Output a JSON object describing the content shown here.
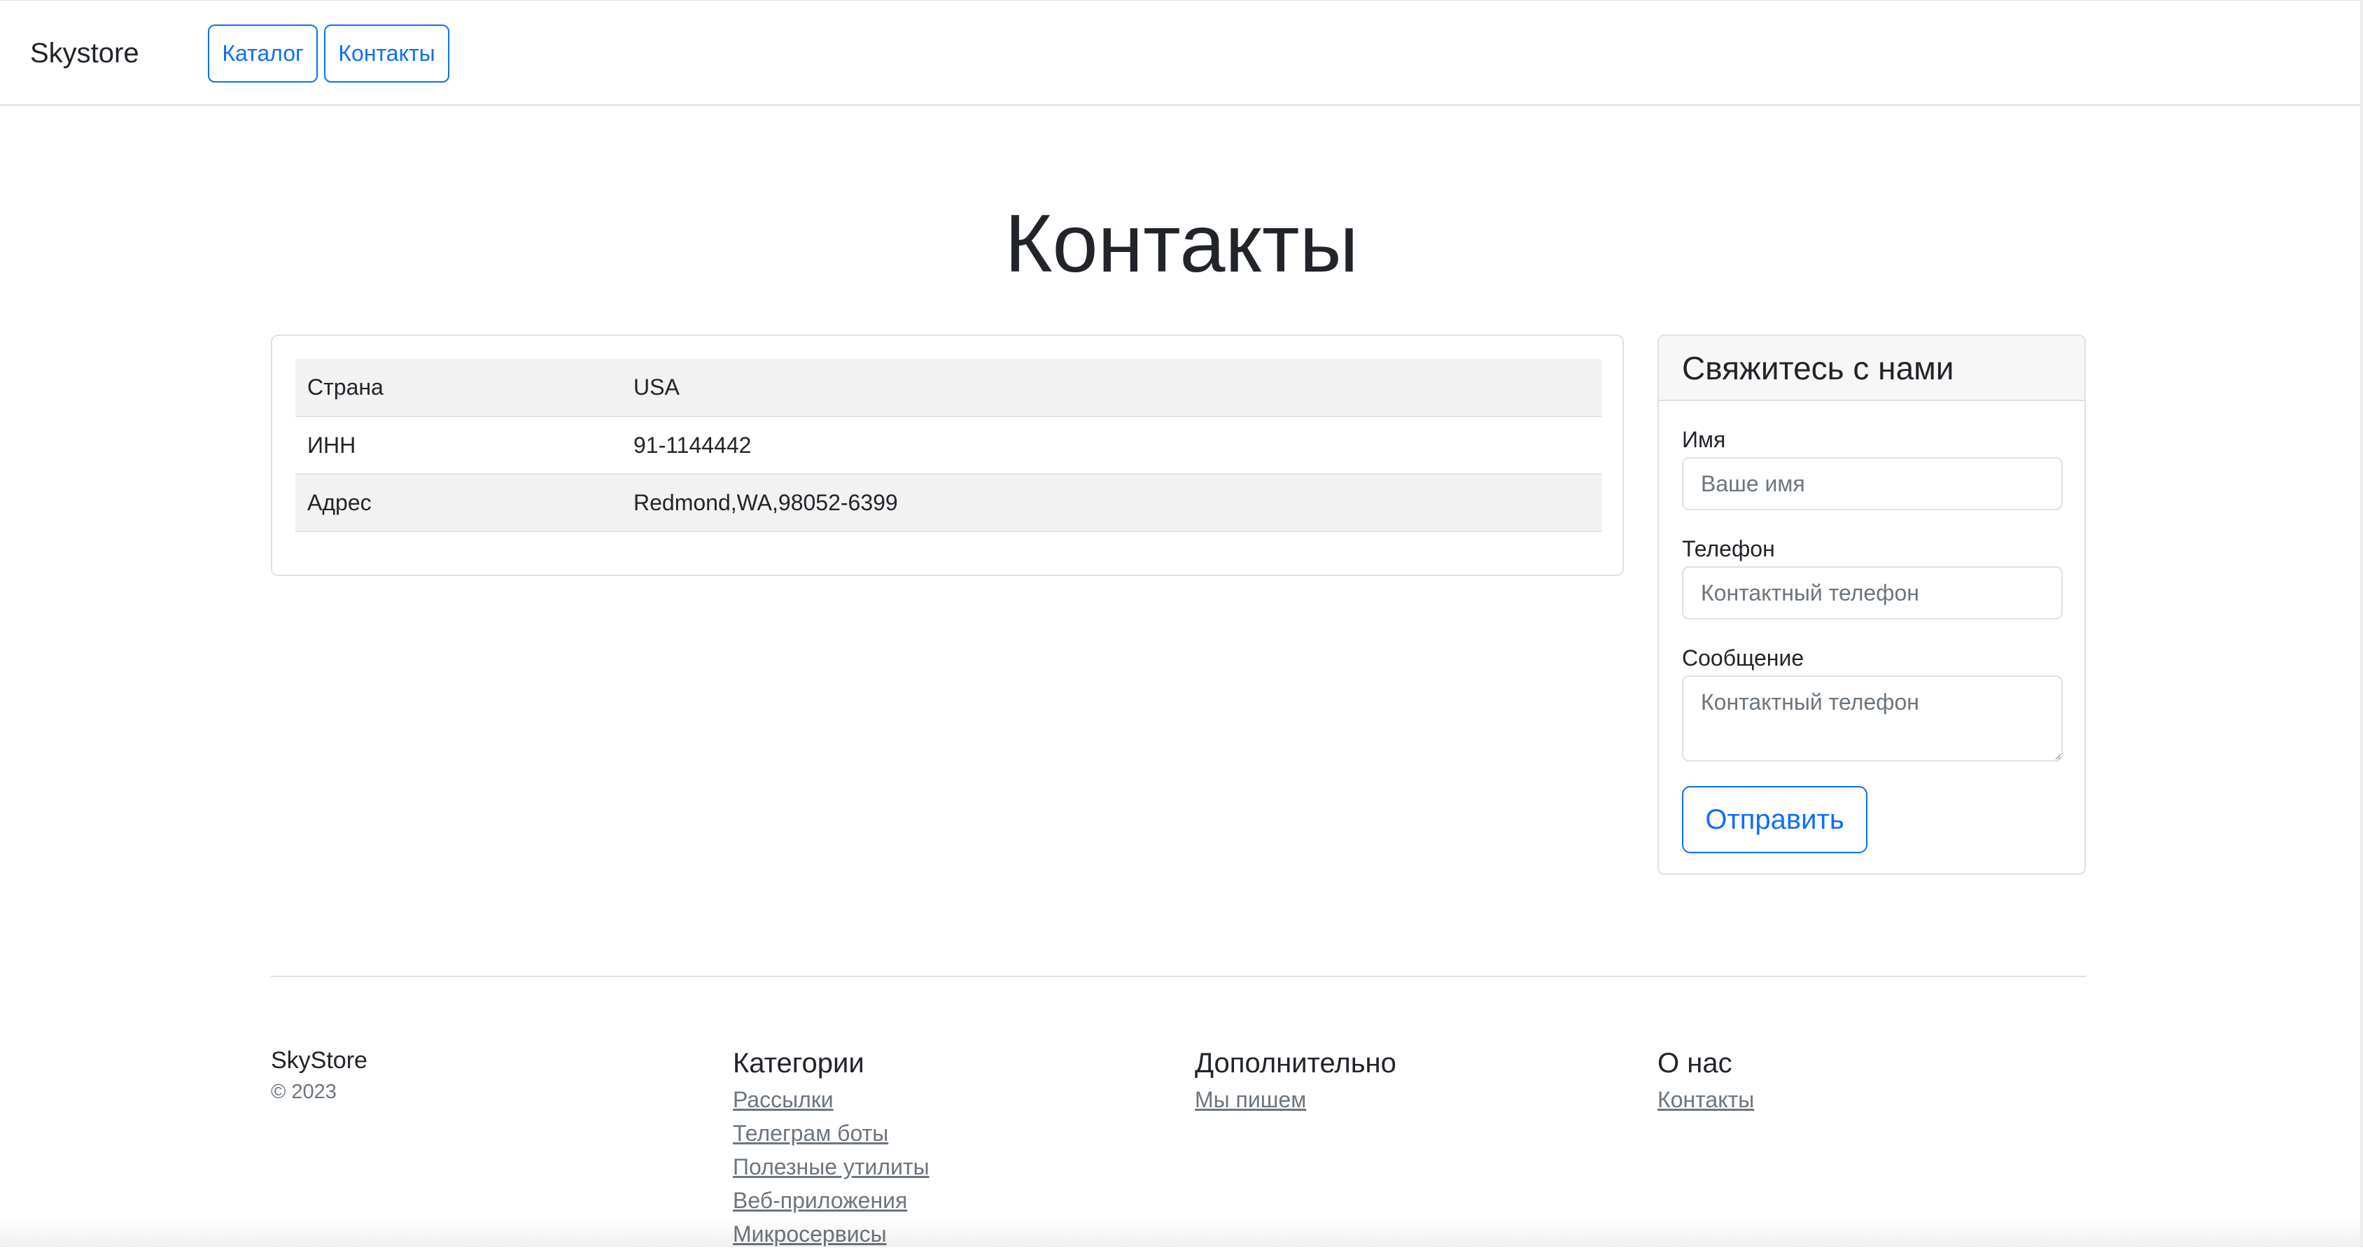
{
  "navbar": {
    "brand": "Skystore",
    "links": [
      "Каталог",
      "Контакты"
    ]
  },
  "page": {
    "title": "Контакты"
  },
  "info": {
    "rows": [
      {
        "key": "Страна",
        "value": "USA"
      },
      {
        "key": "ИНН",
        "value": "91-1144442"
      },
      {
        "key": "Адрес",
        "value": "Redmond,WA,98052-6399"
      }
    ]
  },
  "contact_form": {
    "title": "Свяжитесь с нами",
    "name_label": "Имя",
    "name_placeholder": "Ваше имя",
    "phone_label": "Телефон",
    "phone_placeholder": "Контактный телефон",
    "message_label": "Сообщение",
    "message_placeholder": "Контактный телефон",
    "submit_label": "Отправить"
  },
  "footer": {
    "brand": "SkyStore",
    "copyright": "© 2023",
    "categories": {
      "heading": "Категории",
      "links": [
        "Рассылки",
        "Телеграм боты",
        "Полезные утилиты",
        "Веб-приложения",
        "Микросервисы"
      ]
    },
    "extra": {
      "heading": "Дополнительно",
      "links": [
        "Мы пишем"
      ]
    },
    "about": {
      "heading": "О нас",
      "links": [
        "Контакты"
      ]
    }
  },
  "colors": {
    "accent": "#0d6efd",
    "border": "#dee2e6",
    "muted": "#6c757d",
    "stripe": "#f2f2f2"
  }
}
